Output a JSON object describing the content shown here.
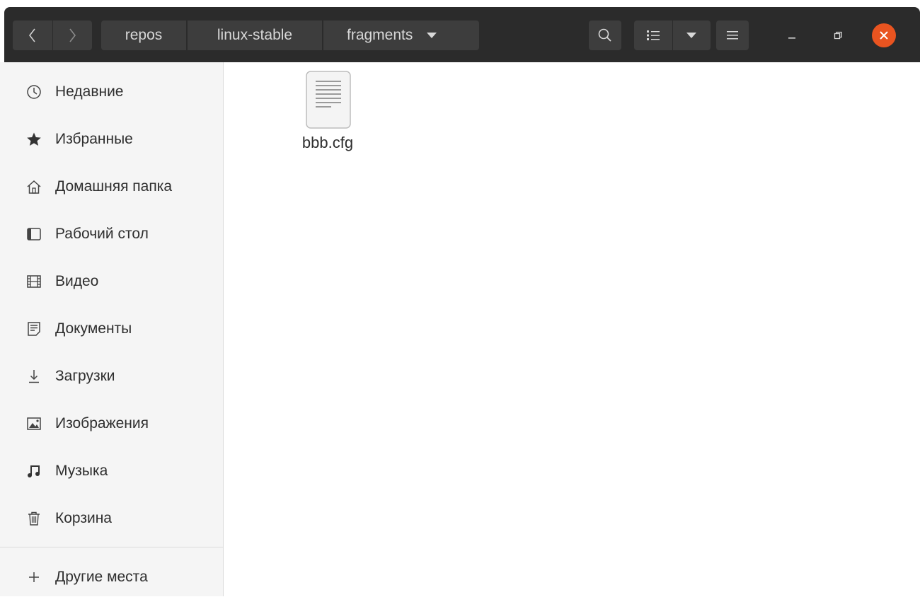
{
  "header": {
    "nav_back_icon": "chevron-left-icon",
    "nav_forward_icon": "chevron-right-icon",
    "breadcrumb": [
      "repos",
      "linux-stable",
      "fragments"
    ],
    "breadcrumb_menu_icon": "caret-down-icon",
    "search_icon": "search-icon",
    "view_list_icon": "list-view-icon",
    "view_options_icon": "caret-down-icon",
    "menu_icon": "hamburger-menu-icon",
    "window_controls": [
      "minimize-icon",
      "restore-icon",
      "close-icon"
    ],
    "close_color": "#e95420"
  },
  "sidebar": {
    "items": [
      {
        "label": "Недавние",
        "icon": "clock-icon"
      },
      {
        "label": "Избранные",
        "icon": "star-icon"
      },
      {
        "label": "Домашняя папка",
        "icon": "home-icon"
      },
      {
        "label": "Рабочий стол",
        "icon": "desktop-icon"
      },
      {
        "label": "Видео",
        "icon": "film-icon"
      },
      {
        "label": "Документы",
        "icon": "document-icon"
      },
      {
        "label": "Загрузки",
        "icon": "download-icon"
      },
      {
        "label": "Изображения",
        "icon": "image-icon"
      },
      {
        "label": "Музыка",
        "icon": "music-icon"
      },
      {
        "label": "Корзина",
        "icon": "trash-icon"
      }
    ],
    "other": {
      "label": "Другие места",
      "icon": "plus-icon"
    }
  },
  "files": [
    {
      "name": "bbb.cfg",
      "icon": "text-file-icon"
    }
  ]
}
